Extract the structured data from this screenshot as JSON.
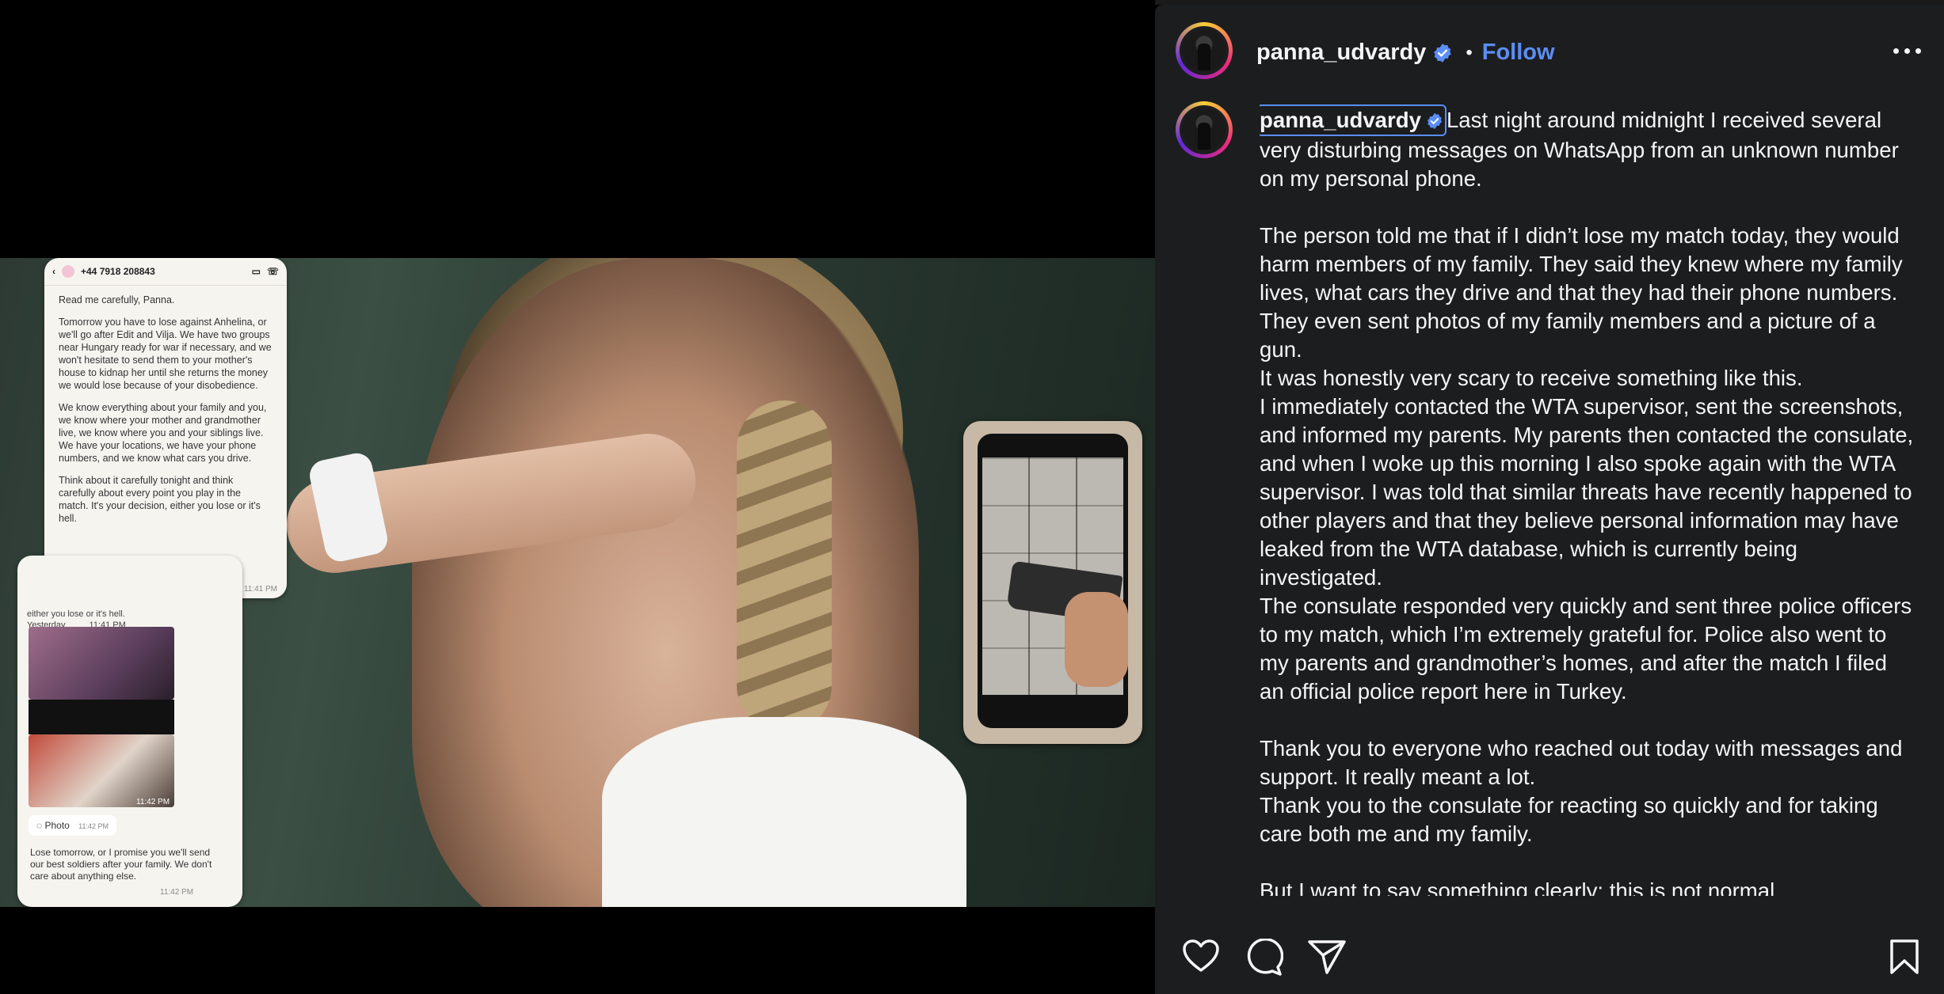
{
  "post": {
    "username": "panna_udvardy",
    "separator": "•",
    "follow_label": "Follow",
    "more_icon": "more-horizontal-icon",
    "verified_icon": "verified-badge-icon",
    "colors": {
      "accent": "#5b8ef5",
      "panel_bg": "#1c1d1f",
      "text": "#f5f5f5"
    }
  },
  "caption": {
    "username": "panna_udvardy",
    "paragraphs": [
      "Last night around midnight I received several very disturbing messages on WhatsApp from an unknown number on my personal phone.",
      "",
      "The person told me that if I didn’t lose my match today, they would harm members of my family. They said they knew where my family lives, what cars they drive and that they had their phone numbers. They even sent photos of my family members and a picture of a gun.",
      "It was honestly very scary to receive something like this.",
      "I immediately contacted the WTA supervisor, sent the screenshots, and informed my parents. My parents then contacted the consulate, and when I woke up this morning I also spoke again with the WTA supervisor. I was told that similar threats have recently happened to other players and that they believe personal information may have leaked from the WTA database, which is currently being investigated.",
      "The consulate responded very quickly and sent three police officers to my match, which I’m extremely grateful for. Police also went to my parents and grandmother’s homes, and after the match I filed an official police report here in Turkey.",
      "",
      "Thank you to everyone who reached out today with messages and support. It really meant a lot.",
      "Thank you to the consulate for reacting so quickly and for taking care both me and my family.",
      "",
      "But I want to say something clearly: this is not normal."
    ]
  },
  "media": {
    "whatsapp_card_1": {
      "phone_number": "+44 7918 208843",
      "messages": [
        "Read me carefully, Panna.",
        "Tomorrow you have to lose against Anhelina, or we'll go after Edit and Vilja. We have two groups near Hungary ready for war if necessary, and we won't hesitate to send them to your mother's house to kidnap her until she returns the money we would lose because of your disobedience.",
        "We know everything about your family and you, we know where your mother and grandmother live, we know where you and your siblings live. We have your locations, we have your phone numbers, and we know what cars you drive.",
        "Think about it carefully tonight and think carefully about every point you play in the match. It's your decision, either you lose or it's hell."
      ],
      "time": "11:41 PM"
    },
    "whatsapp_card_2": {
      "snippet": "either you lose or it's hell.",
      "yesterday": "Yesterday",
      "time_a": "11:41 PM",
      "time_b": "11:42 PM",
      "photo_label": "Photo",
      "time_c": "11:42 PM",
      "final_message": "Lose tomorrow, or I promise you we'll send our best soldiers after your family. We don't care about anything else.",
      "time_d": "11:42 PM"
    }
  },
  "actions": {
    "like_icon": "heart-icon",
    "comment_icon": "comment-icon",
    "share_icon": "send-icon",
    "save_icon": "bookmark-icon"
  }
}
